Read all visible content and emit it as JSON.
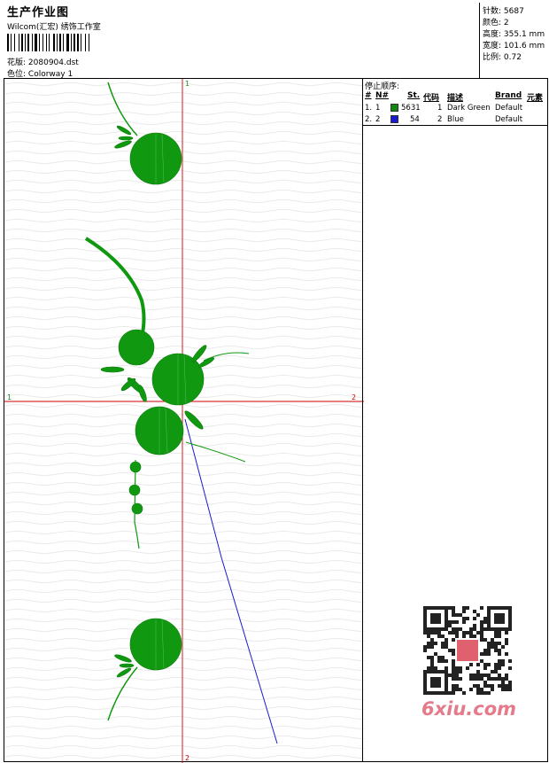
{
  "header": {
    "title": "生产作业图",
    "company": "Wilcom(汇宏) 绣饰工作室",
    "design_label": "花版:",
    "design_value": "2080904.dst",
    "colorway_label": "色位:",
    "colorway_value": "Colorway 1"
  },
  "stats": {
    "stitches_label": "针数:",
    "stitches_value": "5687",
    "colors_label": "颜色:",
    "colors_value": "2",
    "height_label": "高度:",
    "height_value": "355.1 mm",
    "width_label": "宽度:",
    "width_value": "101.6 mm",
    "scale_label": "比例:",
    "scale_value": "0.72"
  },
  "canvas": {
    "axis_top": "1",
    "axis_bottom": "2",
    "axis_left": "1",
    "axis_right": "2",
    "axis_color": "#cc0000",
    "design_green": "#109910",
    "design_blue": "#1a1ad0"
  },
  "stop_sequence": {
    "title": "停止顺序:",
    "columns": [
      "#",
      "N#",
      "St.",
      "代码",
      "描述",
      "Brand",
      "元素"
    ],
    "rows": [
      {
        "index": "1.",
        "n": "1",
        "color": "#118a11",
        "stitches": "5631",
        "code": "1",
        "description": "Dark Green",
        "brand": "Default"
      },
      {
        "index": "2.",
        "n": "2",
        "color": "#1a1ad0",
        "stitches": "54",
        "code": "2",
        "description": "Blue",
        "brand": "Default"
      }
    ]
  },
  "watermark": {
    "text": "6xiu.com",
    "stamp_color": "#e0606e"
  }
}
